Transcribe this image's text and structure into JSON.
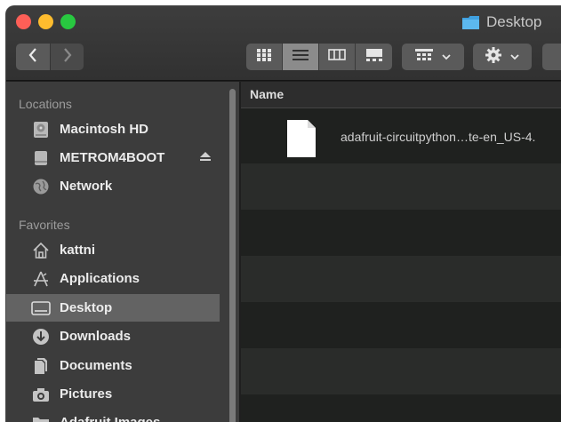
{
  "window": {
    "title": "Desktop"
  },
  "toolbar": {
    "back_icon": "chevron-left",
    "forward_icon": "chevron-right",
    "view_modes": [
      "icon-view",
      "list-view",
      "column-view",
      "gallery-view"
    ],
    "active_view": "list-view",
    "group_icon": "group-grid",
    "action_icon": "gear"
  },
  "sidebar": {
    "locations_header": "Locations",
    "locations": [
      {
        "label": "Macintosh HD",
        "icon": "hard-drive"
      },
      {
        "label": "METROM4BOOT",
        "icon": "external-drive",
        "ejectable": true
      },
      {
        "label": "Network",
        "icon": "globe"
      }
    ],
    "favorites_header": "Favorites",
    "favorites": [
      {
        "label": "kattni",
        "icon": "home"
      },
      {
        "label": "Applications",
        "icon": "applications"
      },
      {
        "label": "Desktop",
        "icon": "desktop",
        "selected": true
      },
      {
        "label": "Downloads",
        "icon": "download"
      },
      {
        "label": "Documents",
        "icon": "documents"
      },
      {
        "label": "Pictures",
        "icon": "camera"
      },
      {
        "label": "Adafruit Images",
        "icon": "folder"
      }
    ]
  },
  "list": {
    "column_name": "Name",
    "files": [
      {
        "name": "adafruit-circuitpython…te-en_US-4.",
        "icon": "document"
      }
    ]
  },
  "colors": {
    "close": "#fd5f57",
    "minimize": "#febc2e",
    "maximize": "#28c840",
    "selection": "#636363",
    "folder_blue": "#3fa0e0"
  }
}
